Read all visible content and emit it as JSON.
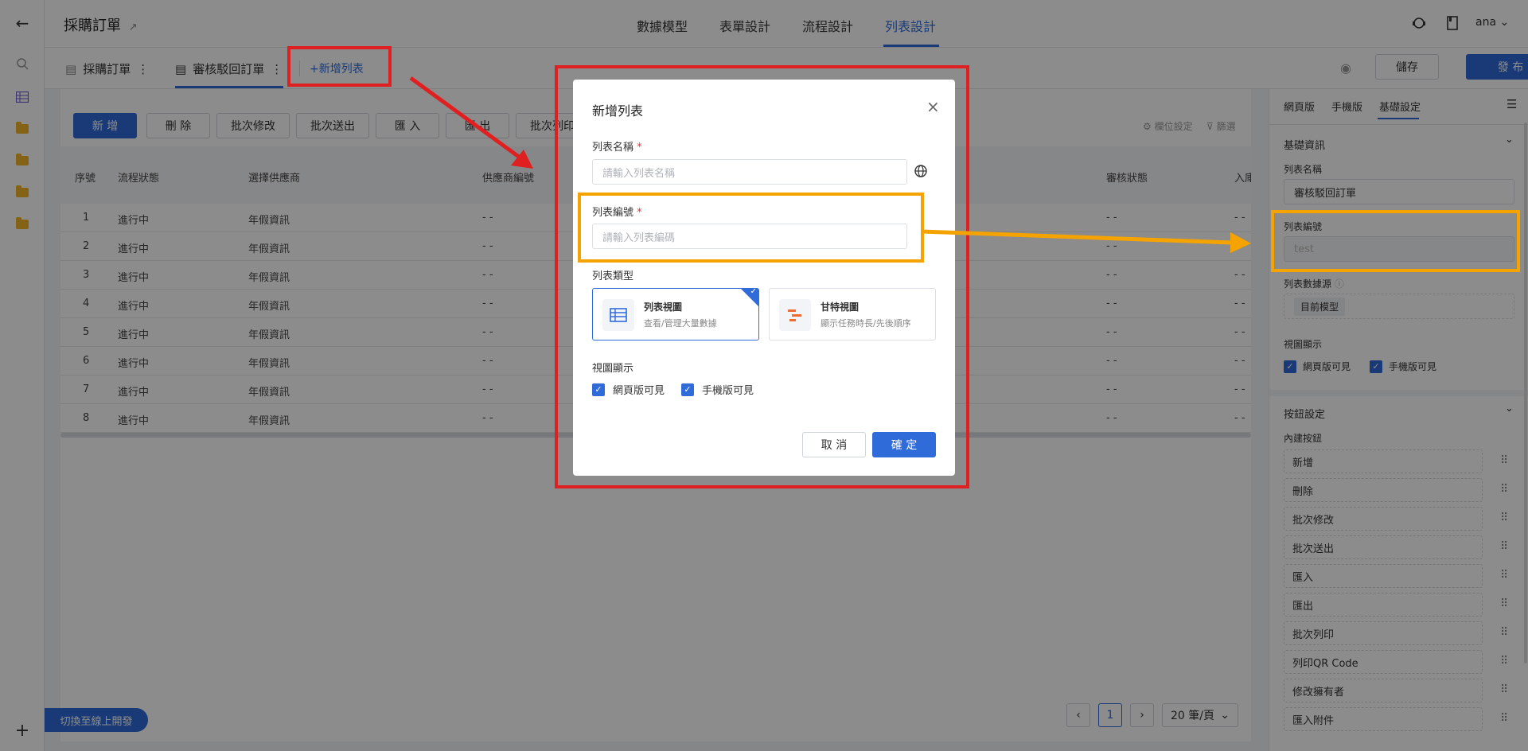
{
  "header": {
    "app_title": "採購訂單",
    "nav": [
      "數據模型",
      "表單設計",
      "流程設計",
      "列表設計"
    ],
    "user": "ana"
  },
  "subheader": {
    "tabs": [
      "採購訂單",
      "審核駁回訂單"
    ],
    "add_list": "+新增列表",
    "save": "儲存",
    "publish": "發 布"
  },
  "toolbar": {
    "buttons": [
      "新 增",
      "刪 除",
      "批次修改",
      "批次送出",
      "匯 入",
      "匯 出",
      "批次列印"
    ],
    "field_settings": "欄位設定",
    "filter": "篩選"
  },
  "table": {
    "headers": [
      "序號",
      "流程狀態",
      "選擇供應商",
      "供應商編號",
      "審核狀態",
      "入庫"
    ],
    "rows": [
      [
        "1",
        "進行中",
        "年假資訊",
        "- -",
        "- -",
        "- -"
      ],
      [
        "2",
        "進行中",
        "年假資訊",
        "- -",
        "- -",
        "- -"
      ],
      [
        "3",
        "進行中",
        "年假資訊",
        "- -",
        "- -",
        "- -"
      ],
      [
        "4",
        "進行中",
        "年假資訊",
        "- -",
        "- -",
        "- -"
      ],
      [
        "5",
        "進行中",
        "年假資訊",
        "- -",
        "- -",
        "- -"
      ],
      [
        "6",
        "進行中",
        "年假資訊",
        "- -",
        "- -",
        "- -"
      ],
      [
        "7",
        "進行中",
        "年假資訊",
        "- -",
        "- -",
        "- -"
      ],
      [
        "8",
        "進行中",
        "年假資訊",
        "- -",
        "- -",
        "- -"
      ]
    ]
  },
  "pagination": {
    "page": "1",
    "page_size": "20 筆/頁"
  },
  "switch_online": "切換至線上開發",
  "right_panel": {
    "tabs": [
      "網頁版",
      "手機版",
      "基礎設定"
    ],
    "basic_info": "基礎資訊",
    "list_name_label": "列表名稱",
    "list_name_value": "審核駁回訂單",
    "list_code_label": "列表編號",
    "list_code_value": "test",
    "data_source_label": "列表數據源",
    "data_source_value": "目前模型",
    "view_display_label": "視圖顯示",
    "web_visible": "網頁版可見",
    "mobile_visible": "手機版可見",
    "button_settings": "按鈕設定",
    "builtin_buttons": "內建按鈕",
    "button_items": [
      "新增",
      "刪除",
      "批次修改",
      "批次送出",
      "匯入",
      "匯出",
      "批次列印",
      "列印QR Code",
      "修改擁有者",
      "匯入附件"
    ]
  },
  "modal": {
    "title": "新增列表",
    "name_label": "列表名稱",
    "name_placeholder": "請輸入列表名稱",
    "code_label": "列表編號",
    "code_placeholder": "請輸入列表編碼",
    "required_mark": "*",
    "type_label": "列表類型",
    "type_list_title": "列表視圖",
    "type_list_sub": "查看/管理大量數據",
    "type_gantt_title": "甘特視圖",
    "type_gantt_sub": "顯示任務時長/先後順序",
    "view_display_label": "視圖顯示",
    "web_visible": "網頁版可見",
    "mobile_visible": "手機版可見",
    "cancel": "取 消",
    "confirm": "確 定"
  },
  "colors": {
    "accent": "#2f6bd9",
    "highlight_red": "#e02020",
    "highlight_orange": "#f5a300",
    "folder": "#f0b429"
  }
}
